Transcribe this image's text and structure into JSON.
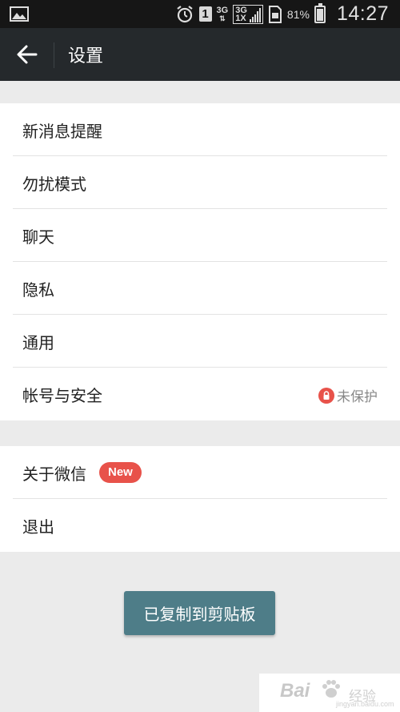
{
  "status_bar": {
    "sim_slot": "1",
    "network_1": "3G",
    "network_2_top": "3G",
    "network_2_bottom": "1X",
    "battery_percent": "81%",
    "battery_level": 0.81,
    "time": "14:27"
  },
  "header": {
    "title": "设置"
  },
  "settings_group_1": {
    "items": [
      {
        "label": "新消息提醒"
      },
      {
        "label": "勿扰模式"
      },
      {
        "label": "聊天"
      },
      {
        "label": "隐私"
      },
      {
        "label": "通用"
      },
      {
        "label": "帐号与安全",
        "status": "未保护"
      }
    ]
  },
  "settings_group_2": {
    "items": [
      {
        "label": "关于微信",
        "badge": "New"
      },
      {
        "label": "退出"
      }
    ]
  },
  "toast": {
    "text": "已复制到剪贴板"
  },
  "watermark": {
    "brand": "Bai",
    "sub": "经验",
    "url": "jingyan.baidu.com"
  },
  "colors": {
    "titlebar": "#25292c",
    "accent_red": "#e8524a",
    "toast_bg": "#4e7d88",
    "page_bg": "#ebebeb"
  }
}
